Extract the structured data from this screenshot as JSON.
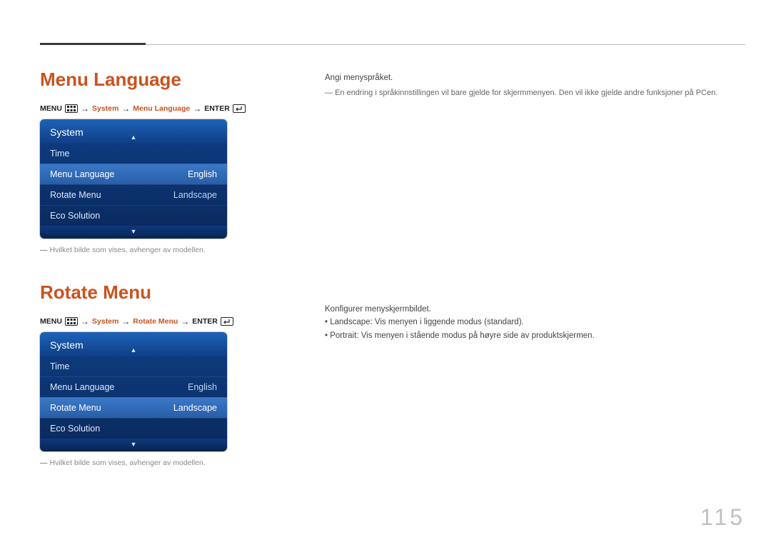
{
  "page_number": "115",
  "section1": {
    "title": "Menu Language",
    "breadcrumb": {
      "p1": "MENU",
      "p2": "System",
      "p3": "Menu Language",
      "p4": "ENTER"
    },
    "osd": {
      "header": "System",
      "rows": [
        {
          "label": "Time",
          "value": ""
        },
        {
          "label": "Menu Language",
          "value": "English"
        },
        {
          "label": "Rotate Menu",
          "value": "Landscape"
        },
        {
          "label": "Eco Solution",
          "value": ""
        }
      ],
      "selected_index": 1
    },
    "note": "Hvilket bilde som vises, avhenger av modellen.",
    "right": {
      "p1": "Angi menyspråket.",
      "p2": "En endring i språkinnstillingen vil bare gjelde for skjermmenyen. Den vil ikke gjelde andre funksjoner på PCen."
    }
  },
  "section2": {
    "title": "Rotate Menu",
    "breadcrumb": {
      "p1": "MENU",
      "p2": "System",
      "p3": "Rotate Menu",
      "p4": "ENTER"
    },
    "osd": {
      "header": "System",
      "rows": [
        {
          "label": "Time",
          "value": ""
        },
        {
          "label": "Menu Language",
          "value": "English"
        },
        {
          "label": "Rotate Menu",
          "value": "Landscape"
        },
        {
          "label": "Eco Solution",
          "value": ""
        }
      ],
      "selected_index": 2
    },
    "note": "Hvilket bilde som vises, avhenger av modellen.",
    "right": {
      "p1": "Konfigurer menyskjermbildet.",
      "b1_label": "Landscape",
      "b1_text": ": Vis menyen i liggende modus (standard).",
      "b2_label": "Portrait",
      "b2_text": ": Vis menyen i stående modus på høyre side av produktskjermen."
    }
  }
}
